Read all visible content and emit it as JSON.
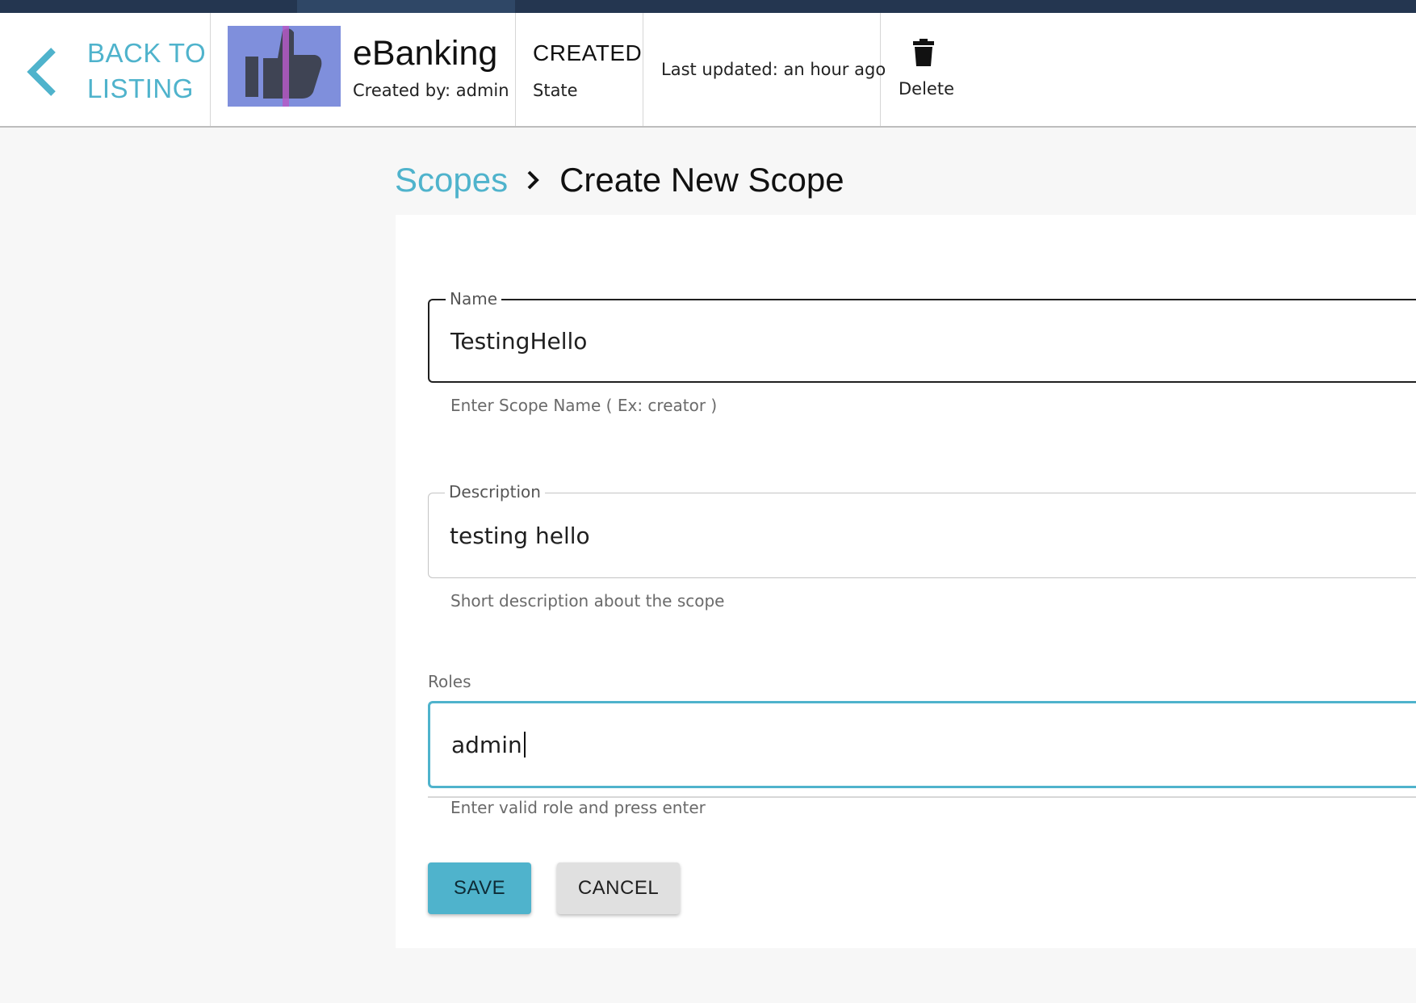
{
  "header": {
    "back_label": "BACK TO LISTING",
    "app_name": "eBanking",
    "created_by": "Created by: admin",
    "state_value": "CREATED",
    "state_label": "State",
    "last_updated": "Last updated: an hour ago",
    "delete_label": "Delete"
  },
  "breadcrumb": {
    "parent": "Scopes",
    "current": "Create New Scope"
  },
  "form": {
    "name": {
      "label": "Name",
      "value": "TestingHello",
      "helper": "Enter Scope Name ( Ex: creator )"
    },
    "description": {
      "label": "Description",
      "value": "testing hello",
      "helper": "Short description about the scope"
    },
    "roles": {
      "label": "Roles",
      "value": "admin",
      "helper": "Enter valid role and press enter"
    },
    "save_label": "SAVE",
    "cancel_label": "CANCEL"
  },
  "colors": {
    "accent": "#4fb3cc",
    "topbar": "#243650",
    "thumb": "#7f8fdc"
  },
  "icons": {
    "back": "chevron-left-icon",
    "app_logo": "thumbs-up-icon",
    "delete": "trash-icon",
    "breadcrumb_separator": "chevron-right-icon"
  }
}
